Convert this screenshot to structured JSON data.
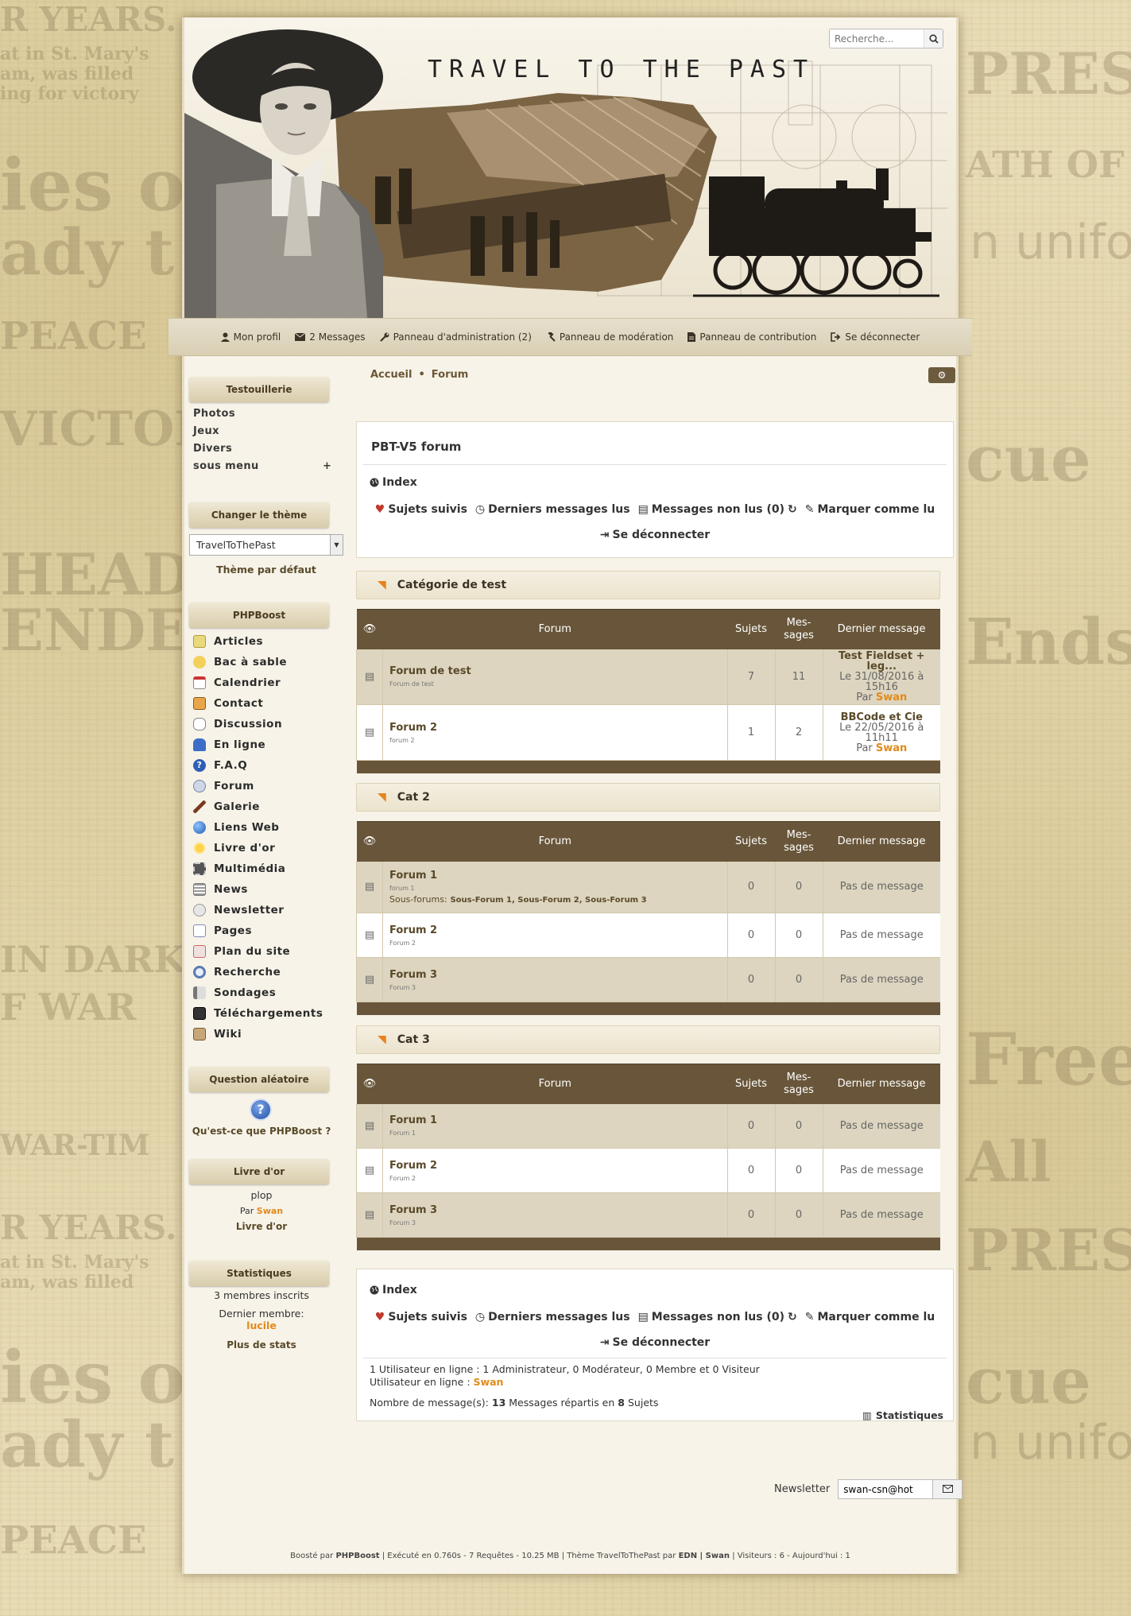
{
  "header": {
    "site_title": "TRAVEL TO THE PAST",
    "search_placeholder": "Recherche..."
  },
  "topnav": [
    {
      "label": "Mon profil",
      "icon": "user-icon"
    },
    {
      "label": "2 Messages",
      "icon": "envelope-icon"
    },
    {
      "label": "Panneau d'administration (2)",
      "icon": "wrench-icon"
    },
    {
      "label": "Panneau de modération",
      "icon": "gavel-icon"
    },
    {
      "label": "Panneau de contribution",
      "icon": "file-icon"
    },
    {
      "label": "Se déconnecter",
      "icon": "sign-out-icon"
    }
  ],
  "sidebar": {
    "testouillerie": {
      "title": "Testouillerie",
      "items": [
        "Photos",
        "Jeux",
        "Divers",
        "sous menu"
      ],
      "expand": "+"
    },
    "theme": {
      "title": "Changer le thème",
      "selected": "TravelToThePast",
      "default_link": "Thème par défaut"
    },
    "phpboost": {
      "title": "PHPBoost",
      "items": [
        "Articles",
        "Bac à sable",
        "Calendrier",
        "Contact",
        "Discussion",
        "En ligne",
        "F.A.Q",
        "Forum",
        "Galerie",
        "Liens Web",
        "Livre d'or",
        "Multimédia",
        "News",
        "Newsletter",
        "Pages",
        "Plan du site",
        "Recherche",
        "Sondages",
        "Téléchargements",
        "Wiki"
      ]
    },
    "question": {
      "title": "Question aléatoire",
      "text": "Qu'est-ce que PHPBoost ?"
    },
    "guestbook": {
      "title": "Livre d'or",
      "message": "plop",
      "by": "Par",
      "author": "Swan",
      "link": "Livre d'or"
    },
    "stats": {
      "title": "Statistiques",
      "members_count": "3",
      "members_label": "membres inscrits",
      "last_member_label": "Dernier membre:",
      "last_member": "lucile",
      "more": "Plus de stats"
    }
  },
  "breadcrumb": [
    "Accueil",
    "Forum"
  ],
  "forum": {
    "title": "PBT-V5 forum",
    "index_label": "Index",
    "actions": [
      "Sujets suivis",
      "Derniers messages lus",
      "Messages non lus (0)",
      "Marquer comme lu"
    ],
    "logout": "Se déconnecter",
    "columns": [
      "Forum",
      "Sujets",
      "Mes-\nsages",
      "Dernier message"
    ],
    "categories": [
      {
        "name": "Catégorie de test",
        "forums": [
          {
            "name": "Forum de test",
            "desc": "Forum de test",
            "topics": "7",
            "messages": "11",
            "last_title": "Test Fieldset + leg...",
            "last_date": "Le 31/08/2016 à 15h16",
            "last_by": "Par",
            "last_author": "Swan"
          },
          {
            "name": "Forum 2",
            "desc": "forum 2",
            "topics": "1",
            "messages": "2",
            "last_title": "BBCode et Cie",
            "last_date": "Le 22/05/2016 à 11h11",
            "last_by": "Par",
            "last_author": "Swan"
          }
        ]
      },
      {
        "name": "Cat 2",
        "forums": [
          {
            "name": "Forum 1",
            "desc": "forum 1",
            "subforums_label": "Sous-forums:",
            "subforums": "Sous-Forum 1, Sous-Forum 2, Sous-Forum 3",
            "topics": "0",
            "messages": "0",
            "none": "Pas de message"
          },
          {
            "name": "Forum 2",
            "desc": "Forum 2",
            "topics": "0",
            "messages": "0",
            "none": "Pas de message"
          },
          {
            "name": "Forum 3",
            "desc": "Forum 3",
            "topics": "0",
            "messages": "0",
            "none": "Pas de message"
          }
        ]
      },
      {
        "name": "Cat 3",
        "forums": [
          {
            "name": "Forum 1",
            "desc": "Forum 1",
            "topics": "0",
            "messages": "0",
            "none": "Pas de message"
          },
          {
            "name": "Forum 2",
            "desc": "Forum 2",
            "topics": "0",
            "messages": "0",
            "none": "Pas de message"
          },
          {
            "name": "Forum 3",
            "desc": "Forum 3",
            "topics": "0",
            "messages": "0",
            "none": "Pas de message"
          }
        ]
      }
    ],
    "online_line": "1 Utilisateur en ligne : 1 Administrateur, 0 Modérateur, 0 Membre et 0 Visiteur",
    "online_users_label": "Utilisateur en ligne :",
    "online_user": "Swan",
    "msg_count_prefix": "Nombre de message(s):",
    "msg_count": "13",
    "msg_count_mid": "Messages répartis en",
    "topic_count": "8",
    "msg_count_suffix": "Sujets",
    "stats_link": "Statistiques"
  },
  "newsletter": {
    "label": "Newsletter",
    "value": "swan-csn@hot"
  },
  "footer": {
    "boosted": "Boosté par",
    "phpboost": "PHPBoost",
    "exec": "| Exécuté en 0.760s - 7 Requêtes - 10.25 MB | Thème TravelToThePast par",
    "edn": "EDN | Swan",
    "visitors": "| Visiteurs : 6 - Aujourd'hui : 1"
  },
  "colors": {
    "accent_brown": "#69563a",
    "author_orange": "#e28a1a",
    "heart_red": "#c0392b",
    "rss_orange": "#e8821e"
  }
}
